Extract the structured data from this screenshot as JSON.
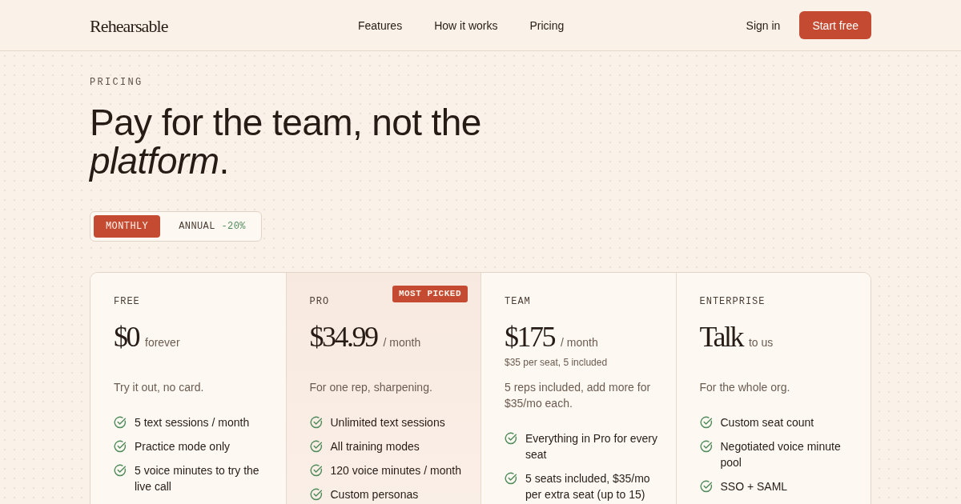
{
  "nav": {
    "logo": "Rehearsable",
    "links": [
      {
        "label": "Features"
      },
      {
        "label": "How it works"
      },
      {
        "label": "Pricing"
      }
    ],
    "sign_in": "Sign in",
    "cta": "Start free"
  },
  "hero": {
    "eyebrow": "PRICING",
    "heading": "Pay for the team, not the *platform*."
  },
  "billing_toggle": [
    {
      "label": "MONTHLY",
      "selected": true
    },
    {
      "label": "ANNUAL",
      "discount": "-20%",
      "selected": false
    }
  ],
  "plans": [
    {
      "name": "FREE",
      "highlighted": false,
      "price": "$0",
      "unit": "forever",
      "description": "Try it out, no card.",
      "features": [
        "5 text sessions / month",
        "Practice mode only",
        "5 voice minutes to try the live call"
      ]
    },
    {
      "name": "PRO",
      "highlighted": true,
      "badge": "MOST PICKED",
      "price": "$34.99",
      "unit": "/ month",
      "description": "For one rep, sharpening.",
      "features": [
        "Unlimited text sessions",
        "All training modes",
        "120 voice minutes / month",
        "Custom personas"
      ]
    },
    {
      "name": "TEAM",
      "highlighted": false,
      "price": "$175",
      "unit": "/ month",
      "note": "$35 per seat, 5 included",
      "description": "5 reps included, add more for $35/mo each.",
      "features": [
        "Everything in Pro for every seat",
        "5 seats included, $35/mo per extra seat (up to 15)"
      ]
    },
    {
      "name": "ENTERPRISE",
      "highlighted": false,
      "price": "Talk",
      "unit": "to us",
      "description": "For the whole org.",
      "features": [
        "Custom seat count",
        "Negotiated voice minute pool",
        "SSO + SAML"
      ]
    }
  ]
}
